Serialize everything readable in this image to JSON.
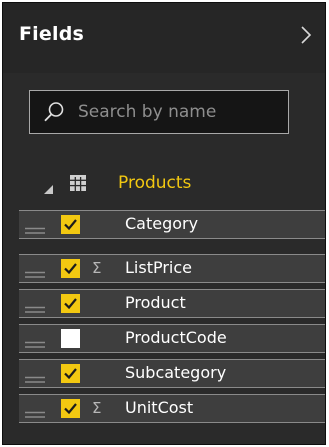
{
  "pane": {
    "title": "Fields",
    "search": {
      "placeholder": "Search by name",
      "value": ""
    },
    "table": {
      "name": "Products"
    },
    "fields": [
      {
        "name": "Category",
        "checked": true,
        "sigma": false
      },
      {
        "name": "ListPrice",
        "checked": true,
        "sigma": true
      },
      {
        "name": "Product",
        "checked": true,
        "sigma": false
      },
      {
        "name": "ProductCode",
        "checked": false,
        "sigma": false
      },
      {
        "name": "Subcategory",
        "checked": true,
        "sigma": false
      },
      {
        "name": "UnitCost",
        "checked": true,
        "sigma": true
      }
    ],
    "sigma_symbol": "Σ",
    "colors": {
      "accent": "#f2c811",
      "pane_bg": "#2a2a2a",
      "header_bg": "#262626",
      "row_bg": "#3e3e3e"
    },
    "icons": {
      "collapse": "chevron-right-icon",
      "search": "search-icon",
      "expand": "expand-triangle-icon",
      "table": "table-icon",
      "drag": "drag-handle-icon",
      "check": "checkbox-icon"
    }
  }
}
